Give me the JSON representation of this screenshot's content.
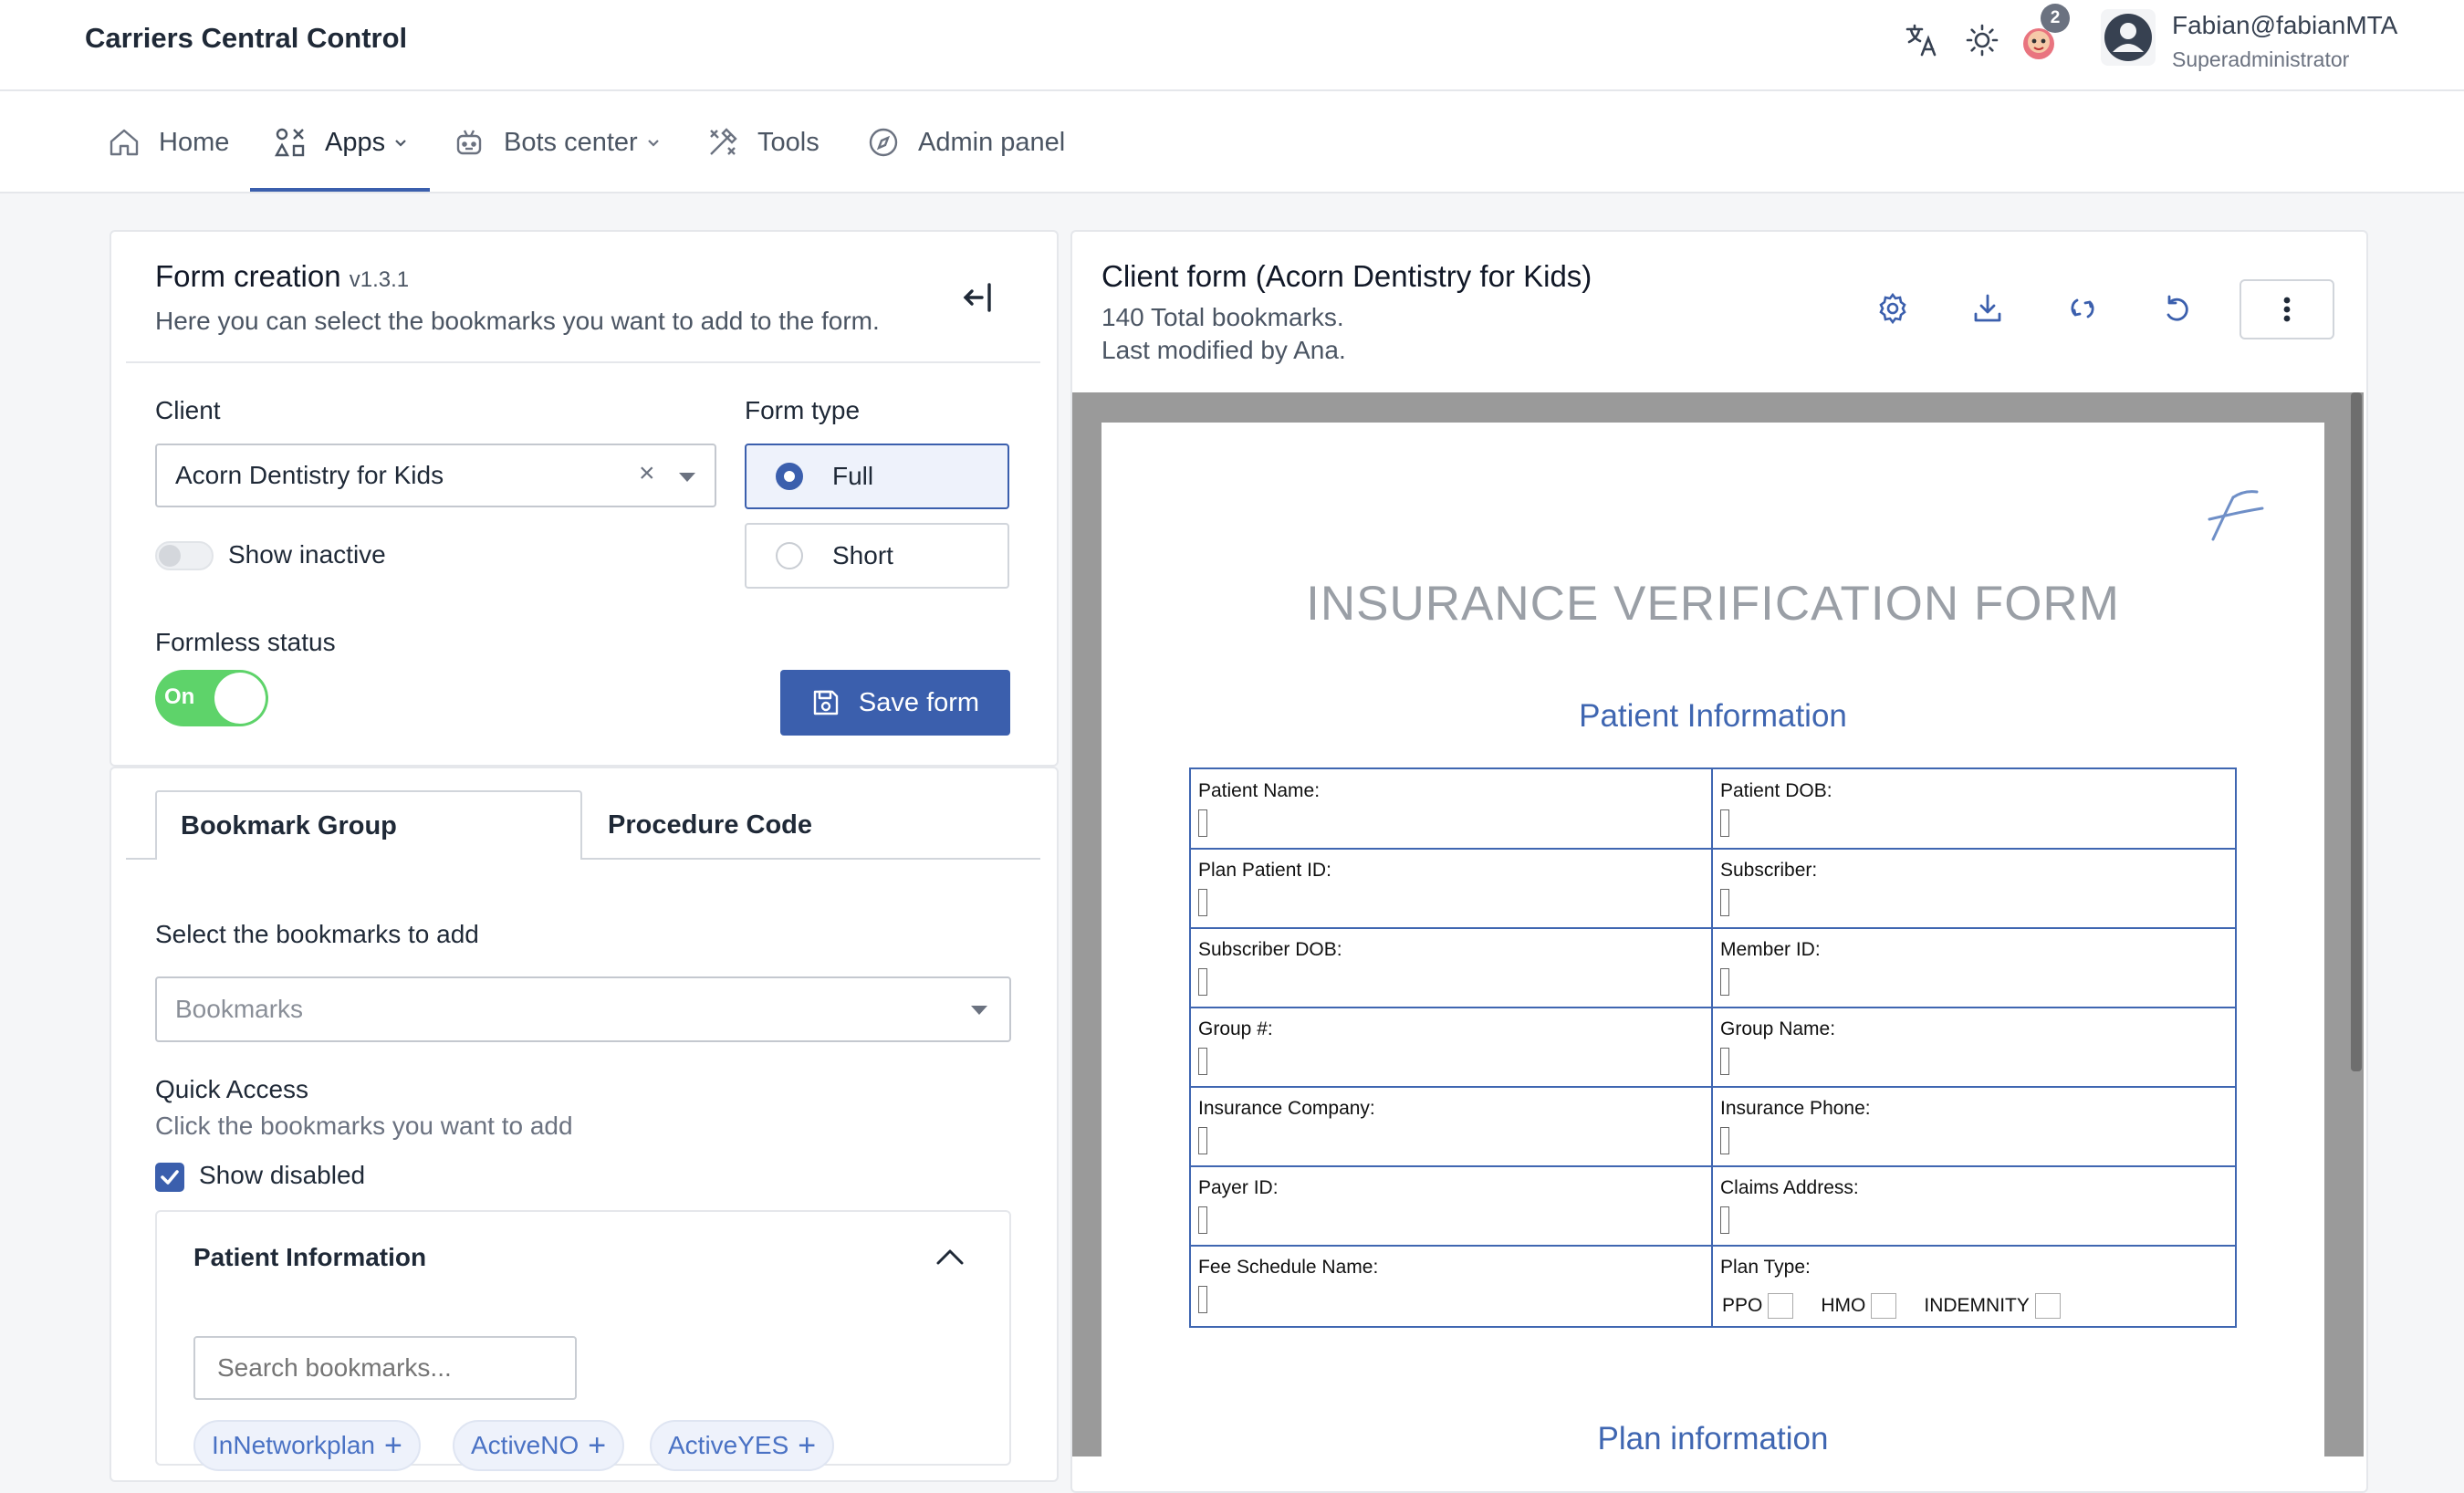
{
  "header": {
    "app_title": "Carriers Central Control",
    "notification_count": "2",
    "user_name": "Fabian@fabianMTA",
    "user_role": "Superadministrator"
  },
  "nav": {
    "home": "Home",
    "apps": "Apps",
    "bots": "Bots center",
    "tools": "Tools",
    "admin": "Admin panel",
    "active": "Apps"
  },
  "form_creation": {
    "title": "Form creation",
    "version": "v1.3.1",
    "subtitle": "Here you can select the bookmarks you want to add to the form.",
    "client_label": "Client",
    "client_value": "Acorn Dentistry for Kids",
    "show_inactive_label": "Show inactive",
    "form_type_label": "Form type",
    "form_type_options": [
      "Full",
      "Short"
    ],
    "form_type_selected": "Full",
    "formless_label": "Formless status",
    "formless_toggle_text": "On",
    "save_label": "Save form"
  },
  "tabs": {
    "bookmark_group": "Bookmark Group",
    "procedure_code": "Procedure Code"
  },
  "bookmarks": {
    "select_label": "Select the bookmarks to add",
    "select_placeholder": "Bookmarks",
    "quick_access_title": "Quick Access",
    "quick_access_hint": "Click the bookmarks you want to add",
    "show_disabled_label": "Show disabled",
    "accordion_title": "Patient Information",
    "search_placeholder": "Search bookmarks...",
    "chips": [
      "InNetworkplan",
      "ActiveNO",
      "ActiveYES"
    ]
  },
  "client_form": {
    "title": "Client form (Acorn Dentistry for Kids)",
    "total": "140 Total bookmarks.",
    "modified": "Last modified by Ana."
  },
  "document": {
    "title": "INSURANCE VERIFICATION FORM",
    "section1": "Patient Information",
    "section2": "Plan information",
    "rows": [
      [
        "Patient Name:",
        "Patient DOB:"
      ],
      [
        "Plan Patient ID:",
        "Subscriber:"
      ],
      [
        "Subscriber DOB:",
        "Member ID:"
      ],
      [
        "Group #:",
        "Group Name:"
      ],
      [
        "Insurance Company:",
        "Insurance Phone:"
      ],
      [
        "Payer ID:",
        "Claims Address:"
      ],
      [
        "Fee Schedule Name:",
        "Plan Type:"
      ]
    ],
    "plan_types": [
      "PPO",
      "HMO",
      "INDEMNITY"
    ]
  },
  "colors": {
    "primary": "#3b5fad",
    "toggle_on": "#5ed36a",
    "doc_blue": "#3f66b1",
    "badge": "#6b7280"
  }
}
